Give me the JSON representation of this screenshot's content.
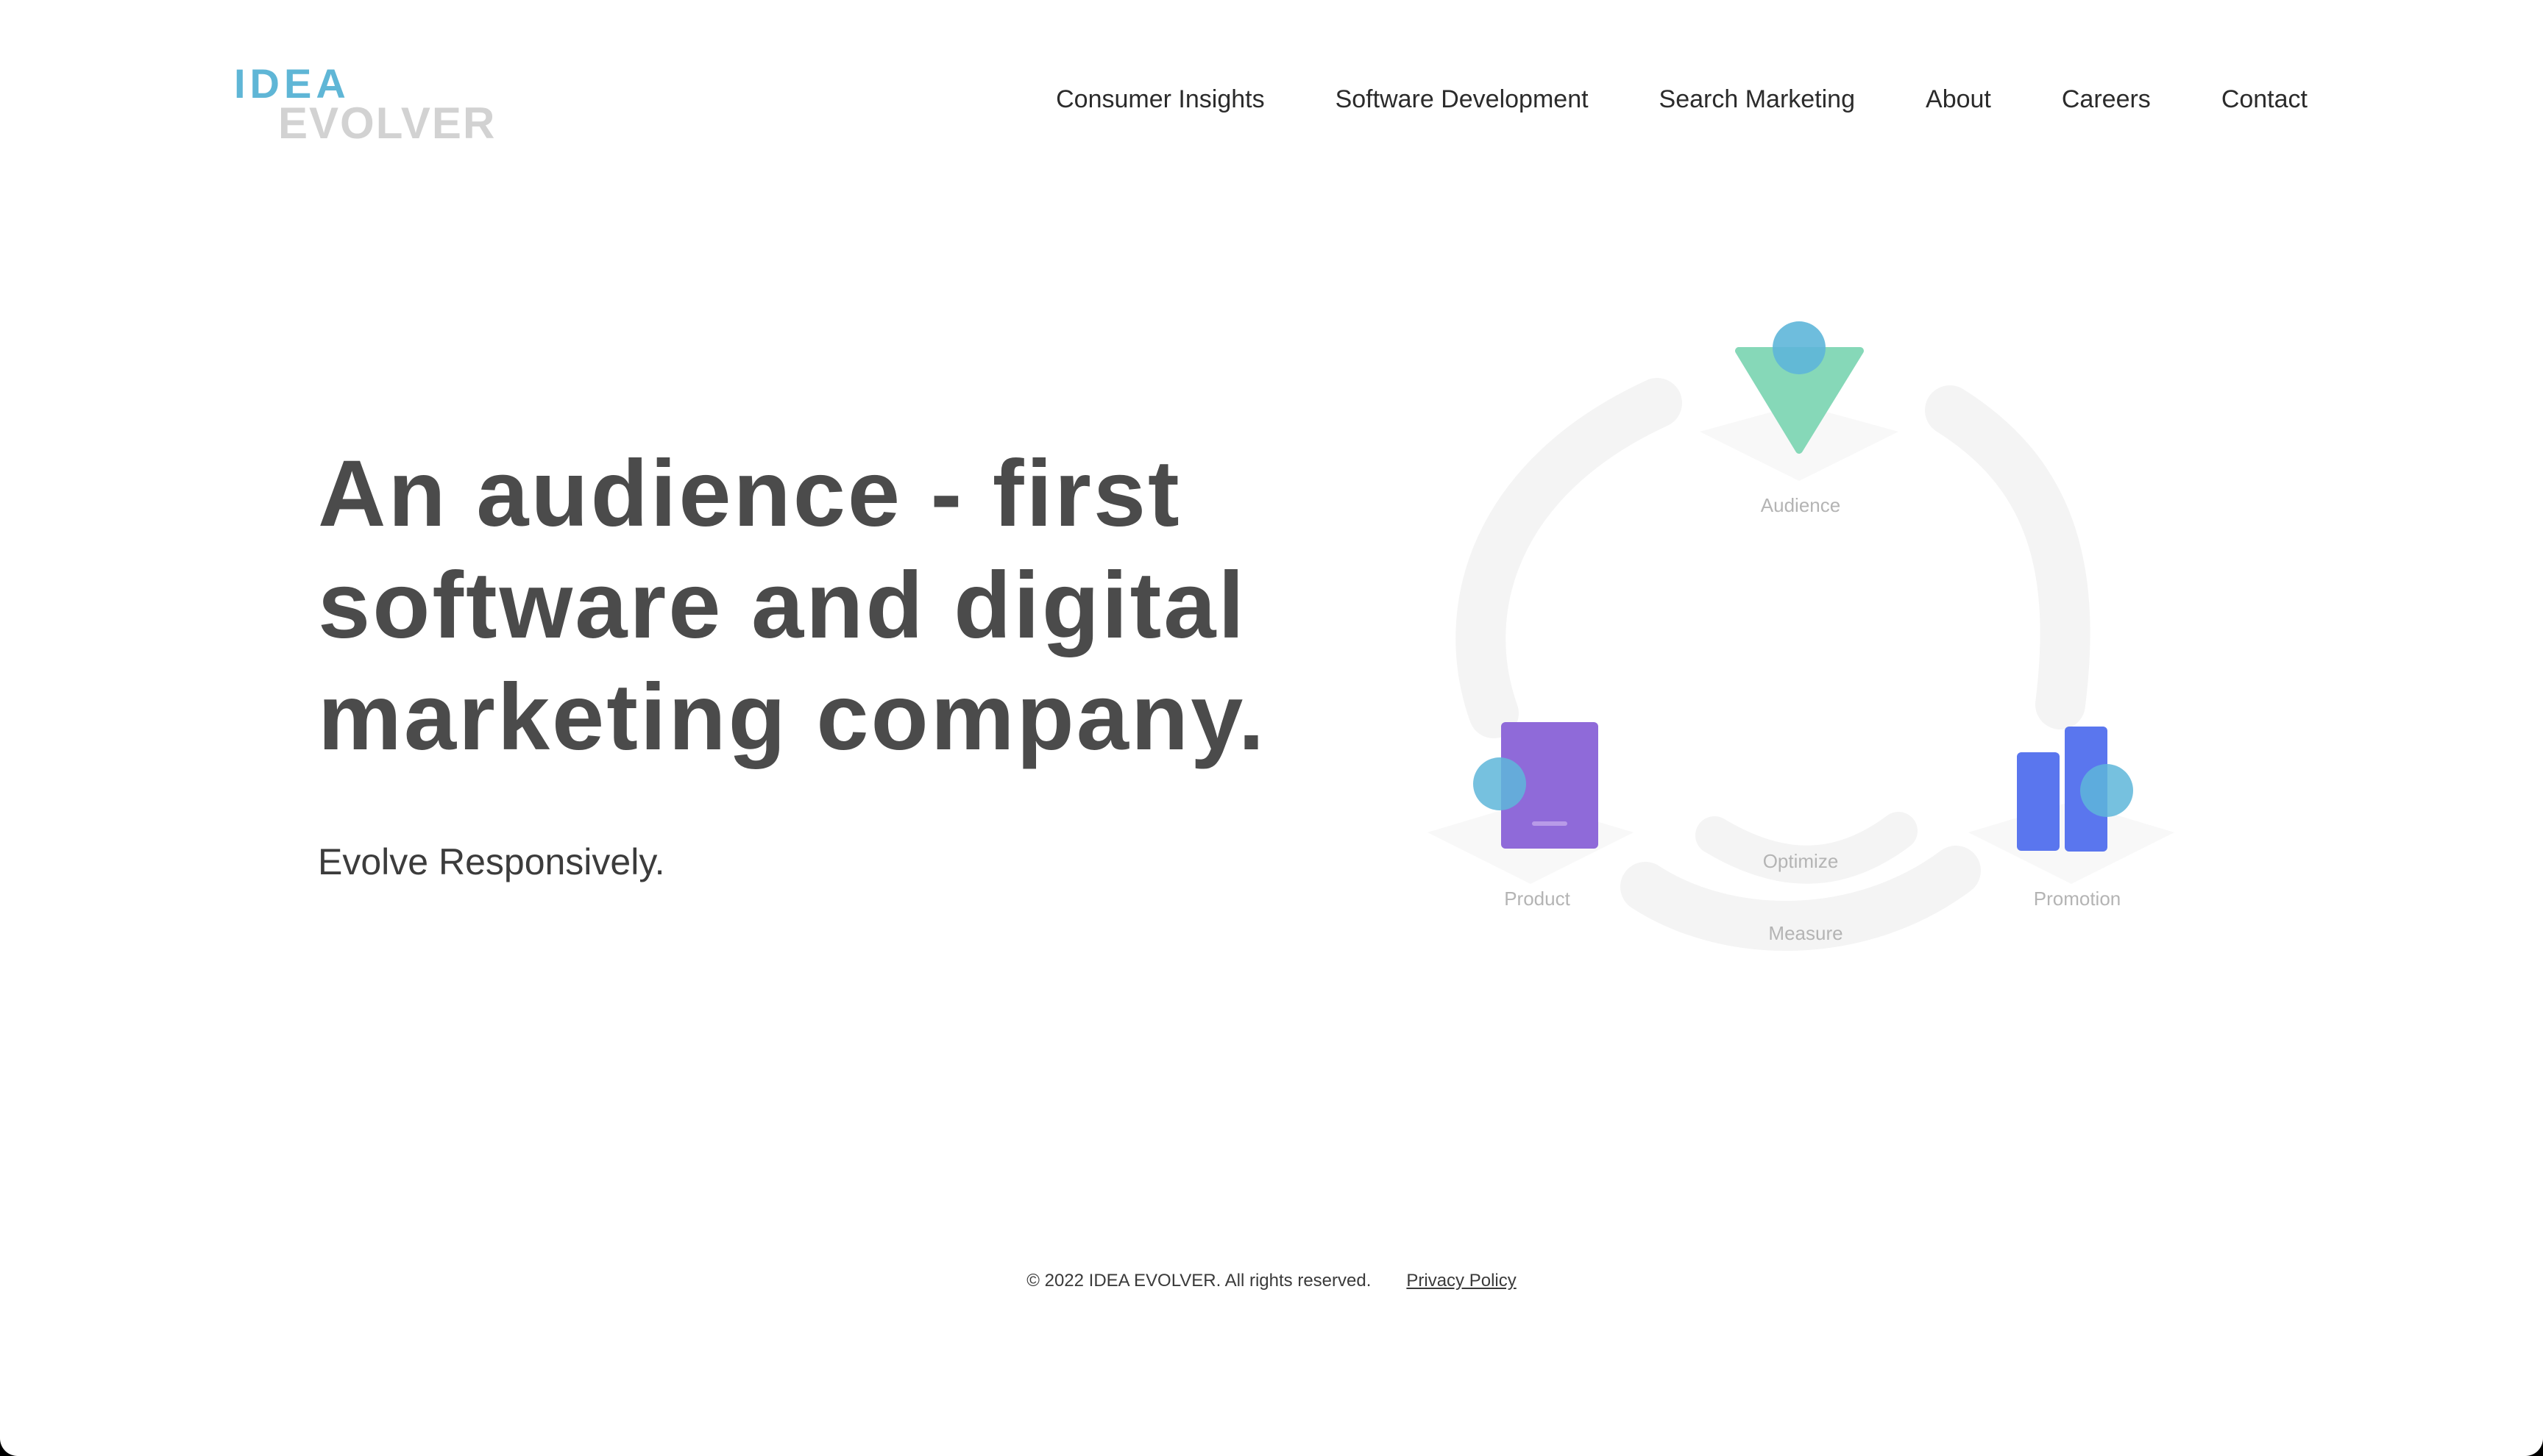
{
  "brand": {
    "logo_top": "IDEA",
    "logo_bottom": "EVOLVER",
    "colors": {
      "logo_top": "#5fb6d6",
      "logo_bottom": "#d2d2d2"
    }
  },
  "nav": {
    "items": [
      {
        "label": "Consumer Insights"
      },
      {
        "label": "Software Development"
      },
      {
        "label": "Search Marketing"
      },
      {
        "label": "About"
      },
      {
        "label": "Careers"
      },
      {
        "label": "Contact"
      }
    ]
  },
  "hero": {
    "headline_lines": [
      "An audience - first",
      "software and digital",
      "marketing company."
    ],
    "tagline": "Evolve Responsively."
  },
  "diagram": {
    "labels": {
      "audience": "Audience",
      "product": "Product",
      "promotion": "Promotion",
      "optimize": "Optimize",
      "measure": "Measure"
    },
    "icons": {
      "audience": "triangle-audience-icon",
      "product": "product-card-icon",
      "promotion": "promotion-bars-icon"
    },
    "colors": {
      "triangle": "#86d8b8",
      "bubble": "#5eb6d9",
      "product": "#8f6ad9",
      "promotion": "#5a76ee",
      "ring": "#f4f4f4"
    }
  },
  "footer": {
    "copyright": "© 2022 IDEA EVOLVER. All rights reserved.",
    "privacy_label": "Privacy Policy"
  }
}
